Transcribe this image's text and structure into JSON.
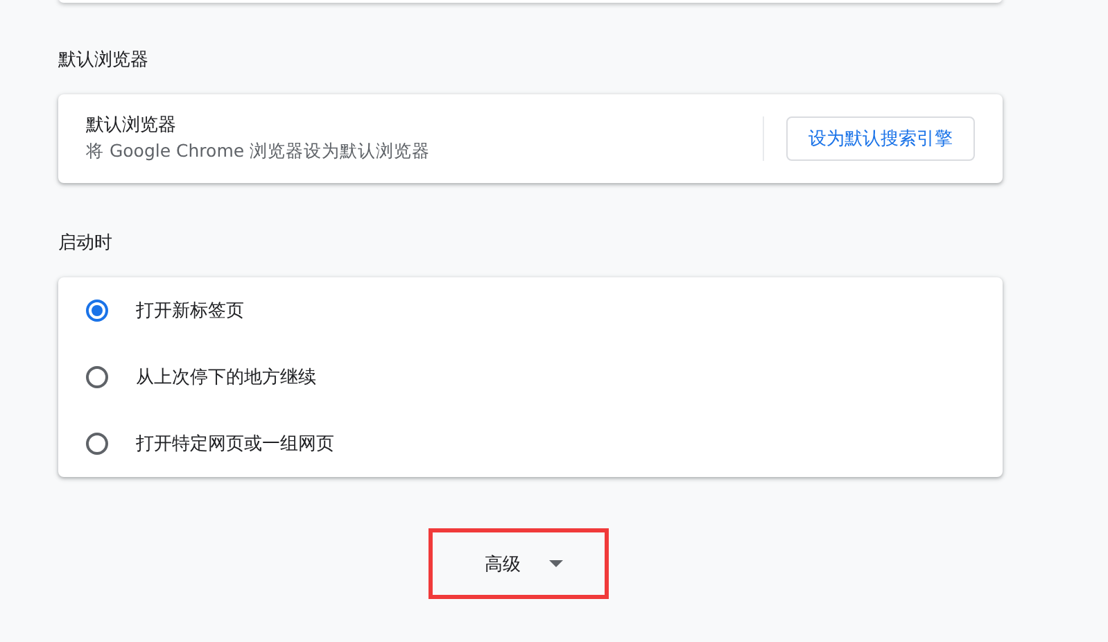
{
  "sections": [
    {
      "kind": "default_browser",
      "title": "默认浏览器",
      "card": {
        "label": "默认浏览器",
        "description": "将 Google Chrome 浏览器设为默认浏览器",
        "button": "设为默认搜索引擎"
      }
    },
    {
      "kind": "startup",
      "title": "启动时",
      "options": [
        {
          "label": "打开新标签页",
          "selected": true
        },
        {
          "label": "从上次停下的地方继续",
          "selected": false
        },
        {
          "label": "打开特定网页或一组网页",
          "selected": false
        }
      ]
    }
  ],
  "advanced": {
    "label": "高级",
    "highlighted": true
  }
}
